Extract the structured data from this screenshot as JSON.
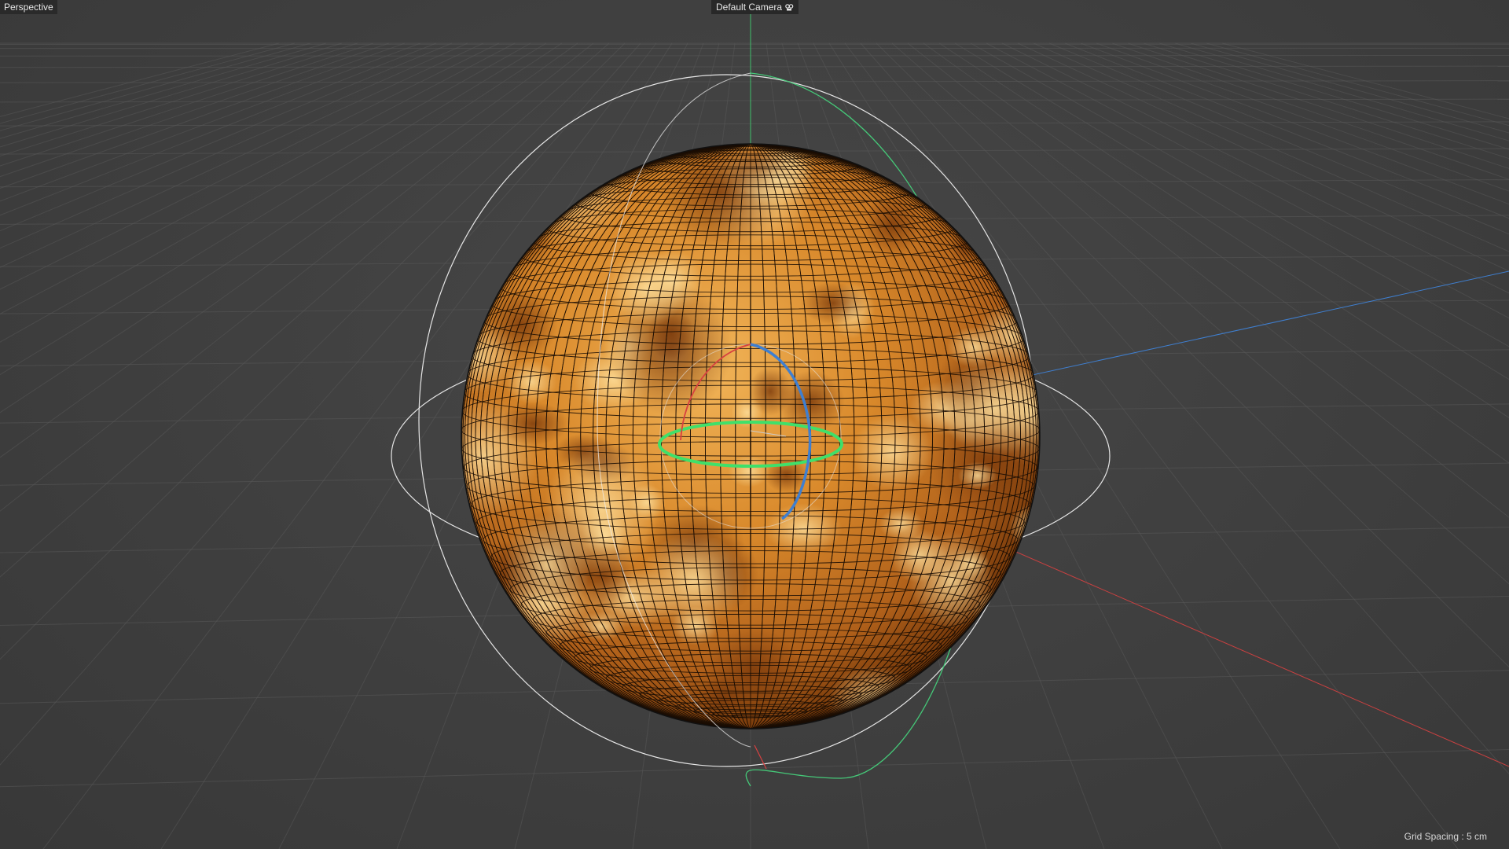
{
  "viewport": {
    "view_name": "Perspective",
    "camera_name": "Default Camera",
    "grid_spacing": "Grid Spacing : 5 cm"
  },
  "scene": {
    "object": "sphere",
    "material": "venus-like orange texture",
    "gizmo": "rotate",
    "colors": {
      "background": "#3f3f3f",
      "grid": "#555555",
      "axis_x": "#c84040",
      "axis_y": "#3fbf6a",
      "axis_z": "#3f7fd0",
      "sphere_base": "#c8761f",
      "sphere_light": "#f4c46a",
      "sphere_dark": "#7a3f0c",
      "wire": "#1a0d04",
      "gizmo_white": "#e6e6e6"
    },
    "icons": {
      "camera": "camera-icon"
    }
  }
}
